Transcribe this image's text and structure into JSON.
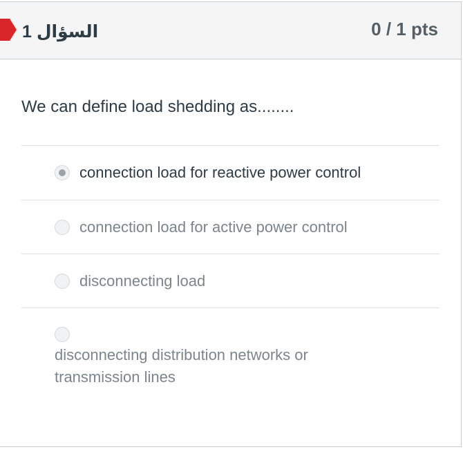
{
  "header": {
    "question_label": "السؤال 1",
    "points": "0 / 1 pts"
  },
  "question": {
    "text": "We can define load shedding as........"
  },
  "answers": [
    {
      "label": "connection load for reactive power control",
      "selected": true
    },
    {
      "label": "connection load for active power control",
      "selected": false
    },
    {
      "label": "disconnecting load",
      "selected": false
    },
    {
      "label": "disconnecting distribution networks or transmission lines",
      "selected": false
    }
  ],
  "colors": {
    "flag": "#d9262b",
    "header_bg": "#f5f5f5",
    "text_dark": "#2d3b45",
    "text_muted": "#7b858b"
  }
}
